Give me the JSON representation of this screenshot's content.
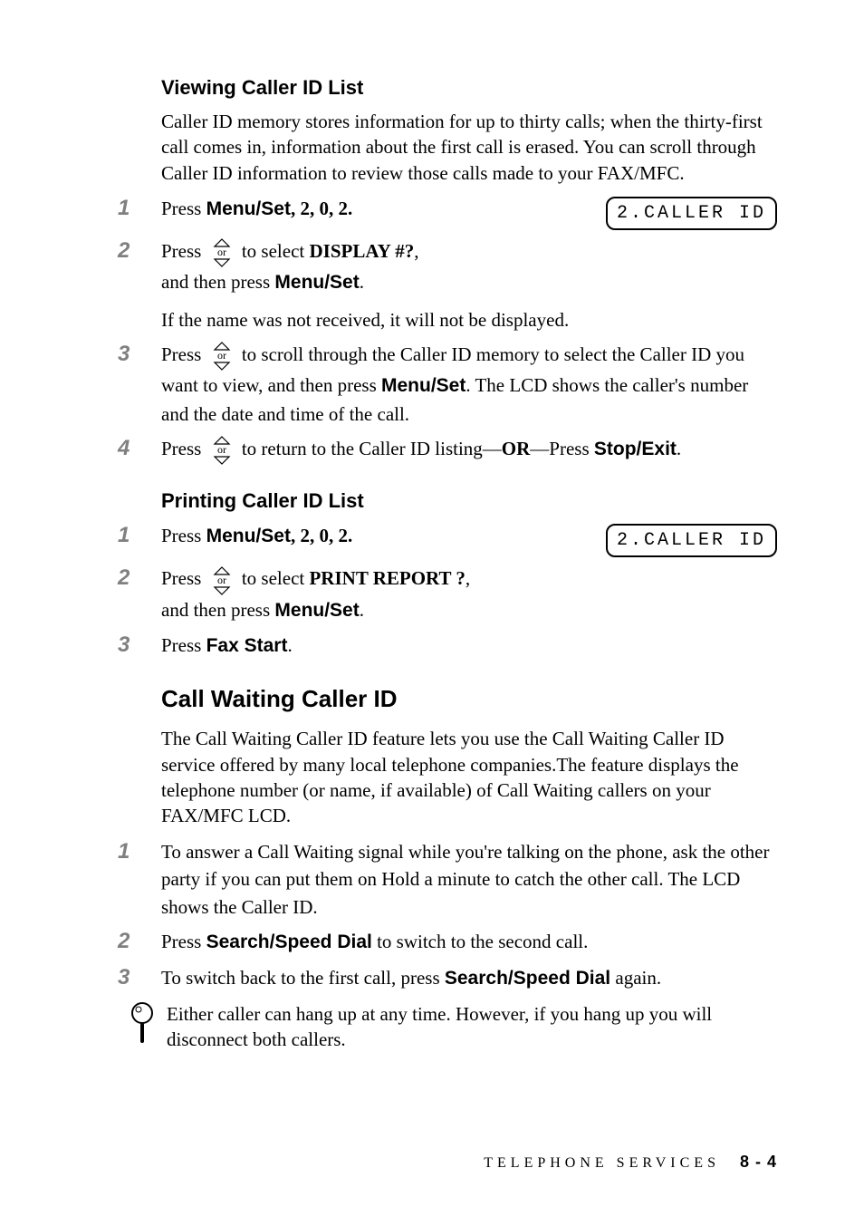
{
  "section1": {
    "heading": "Viewing Caller ID List",
    "intro": "Caller ID memory stores information for up to thirty calls; when the thirty-first call comes in, information about the first call is erased. You can scroll through Caller ID information to review those calls made to your FAX/MFC.",
    "steps": {
      "s1": {
        "press": "Press ",
        "menuSet": "Menu/Set",
        "seq": ", 2, 0, 2.",
        "lcd": "2.CALLER ID"
      },
      "s2": {
        "press": "Press ",
        "mid": " to select ",
        "displayNo": "DISPLAY #?",
        "comma": ",",
        "line2a": "and then press ",
        "menuSet": "Menu/Set",
        "dot": ".",
        "note": "If the name was not received, it will not be displayed."
      },
      "s3": {
        "press": "Press ",
        "mid": " to scroll through the Caller ID memory to select the Caller ID you want to view, and then press ",
        "menuSet": "Menu/Set",
        "after": ". The LCD shows the caller's number and the date and time of the call."
      },
      "s4": {
        "press": "Press ",
        "mid": " to return to the Caller ID listing—",
        "or": "OR",
        "dashPress": "—Press ",
        "stopExit": "Stop/Exit",
        "dot": "."
      }
    }
  },
  "section2": {
    "heading": "Printing Caller ID List",
    "steps": {
      "s1": {
        "press": "Press ",
        "menuSet": "Menu/Set",
        "seq": ", 2, 0, 2.",
        "lcd": "2.CALLER ID"
      },
      "s2": {
        "press": "Press ",
        "mid": " to select ",
        "printReport": "PRINT REPORT ?",
        "comma": ",",
        "line2a": "and then press ",
        "menuSet": "Menu/Set",
        "dot": "."
      },
      "s3": {
        "press": "Press ",
        "faxStart": "Fax Start",
        "dot": "."
      }
    }
  },
  "section3": {
    "heading": "Call Waiting Caller ID",
    "intro": "The Call Waiting Caller ID feature lets you use the Call Waiting Caller ID service offered by many local telephone companies.The feature displays the telephone number (or name, if available) of Call Waiting callers on your FAX/MFC LCD.",
    "steps": {
      "s1": "To answer a Call Waiting signal while you're talking on the phone, ask the other party if you can put them on Hold a minute to catch the other call. The LCD shows the Caller ID.",
      "s2": {
        "press": "Press ",
        "ssd": "Search/Speed Dial",
        "after": " to switch to the second call."
      },
      "s3": {
        "before": "To switch back to the first call, press ",
        "ssd": "Search/Speed Dial",
        "after": " again."
      }
    },
    "tip": "Either caller can hang up at any time. However, if you hang up you will disconnect both callers."
  },
  "footer": {
    "label": "TELEPHONE SERVICES",
    "page": "8 - 4"
  },
  "nums": {
    "n1": "1",
    "n2": "2",
    "n3": "3",
    "n4": "4"
  }
}
